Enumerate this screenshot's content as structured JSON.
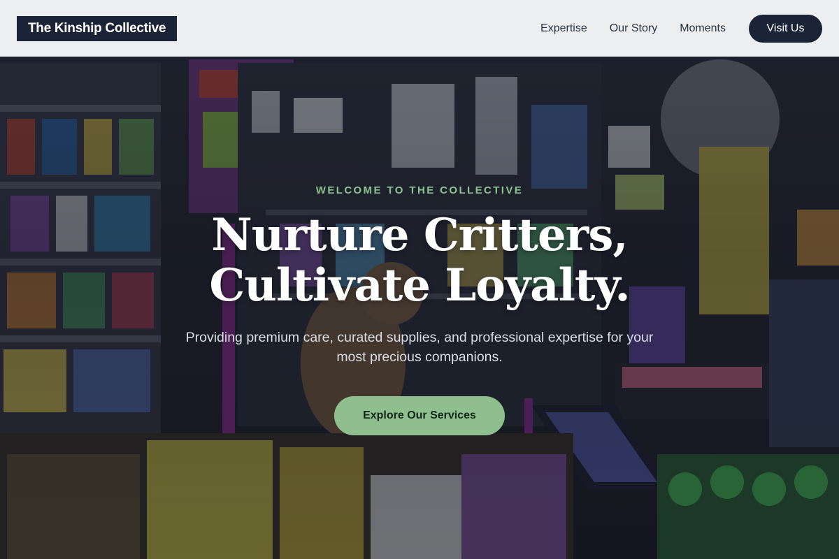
{
  "header": {
    "brand": "The Kinship Collective",
    "nav": [
      {
        "label": "Expertise"
      },
      {
        "label": "Our Story"
      },
      {
        "label": "Moments"
      }
    ],
    "visit_label": "Visit Us"
  },
  "hero": {
    "eyebrow": "WELCOME TO THE COLLECTIVE",
    "headline": "Nurture Critters, Cultivate Loyalty.",
    "subtext": "Providing premium care, curated supplies, and professional expertise for your most precious companions.",
    "cta_label": "Explore Our Services",
    "background_image": "shop-interior-with-dog-photo"
  },
  "colors": {
    "brand_dark": "#1b2436",
    "accent_green": "#8fbf8e",
    "eyebrow_green": "#8cc48f",
    "header_bg": "#f6f7f9"
  }
}
